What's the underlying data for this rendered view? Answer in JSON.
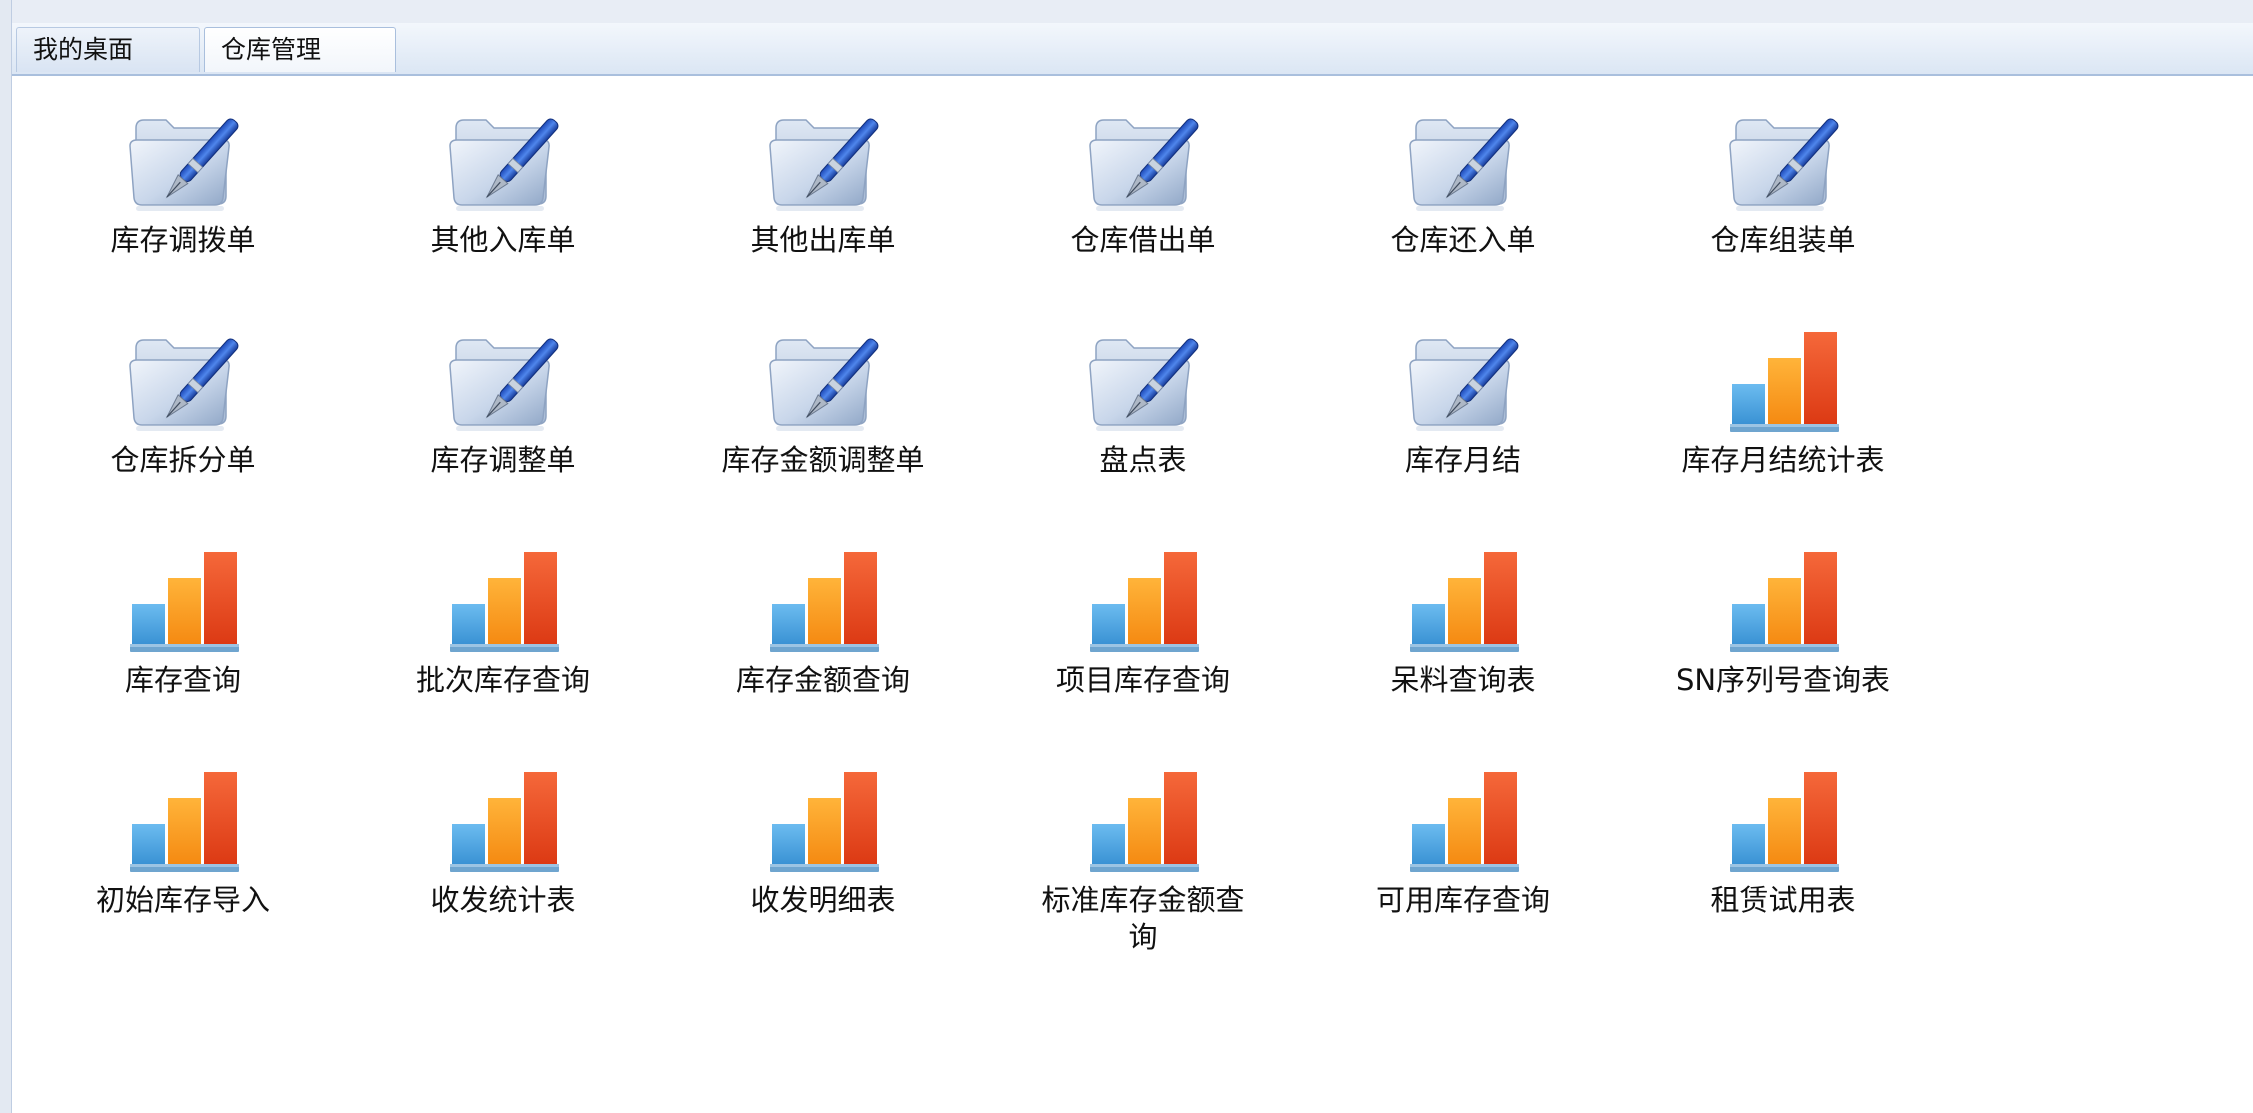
{
  "tabs": [
    {
      "label": "我的桌面",
      "active": false
    },
    {
      "label": "仓库管理",
      "active": true
    }
  ],
  "icon_types": {
    "folder": "folder-pen-icon",
    "chart": "bar-chart-icon"
  },
  "colors": {
    "bar_blue": "#4aa3df",
    "bar_orange": "#f99b1c",
    "bar_red": "#e8431d"
  },
  "items": [
    {
      "label": "库存调拨单",
      "icon": "folder"
    },
    {
      "label": "其他入库单",
      "icon": "folder"
    },
    {
      "label": "其他出库单",
      "icon": "folder"
    },
    {
      "label": "仓库借出单",
      "icon": "folder"
    },
    {
      "label": "仓库还入单",
      "icon": "folder"
    },
    {
      "label": "仓库组装单",
      "icon": "folder"
    },
    {
      "label": "仓库拆分单",
      "icon": "folder"
    },
    {
      "label": "库存调整单",
      "icon": "folder"
    },
    {
      "label": "库存金额调整单",
      "icon": "folder"
    },
    {
      "label": "盘点表",
      "icon": "folder"
    },
    {
      "label": "库存月结",
      "icon": "folder"
    },
    {
      "label": "库存月结统计表",
      "icon": "chart"
    },
    {
      "label": "库存查询",
      "icon": "chart"
    },
    {
      "label": "批次库存查询",
      "icon": "chart"
    },
    {
      "label": "库存金额查询",
      "icon": "chart"
    },
    {
      "label": "项目库存查询",
      "icon": "chart"
    },
    {
      "label": "呆料查询表",
      "icon": "chart"
    },
    {
      "label": "SN序列号查询表",
      "icon": "chart"
    },
    {
      "label": "初始库存导入",
      "icon": "chart"
    },
    {
      "label": "收发统计表",
      "icon": "chart"
    },
    {
      "label": "收发明细表",
      "icon": "chart"
    },
    {
      "label": "标准库存金额查询",
      "icon": "chart"
    },
    {
      "label": "可用库存查询",
      "icon": "chart"
    },
    {
      "label": "租赁试用表",
      "icon": "chart"
    }
  ]
}
